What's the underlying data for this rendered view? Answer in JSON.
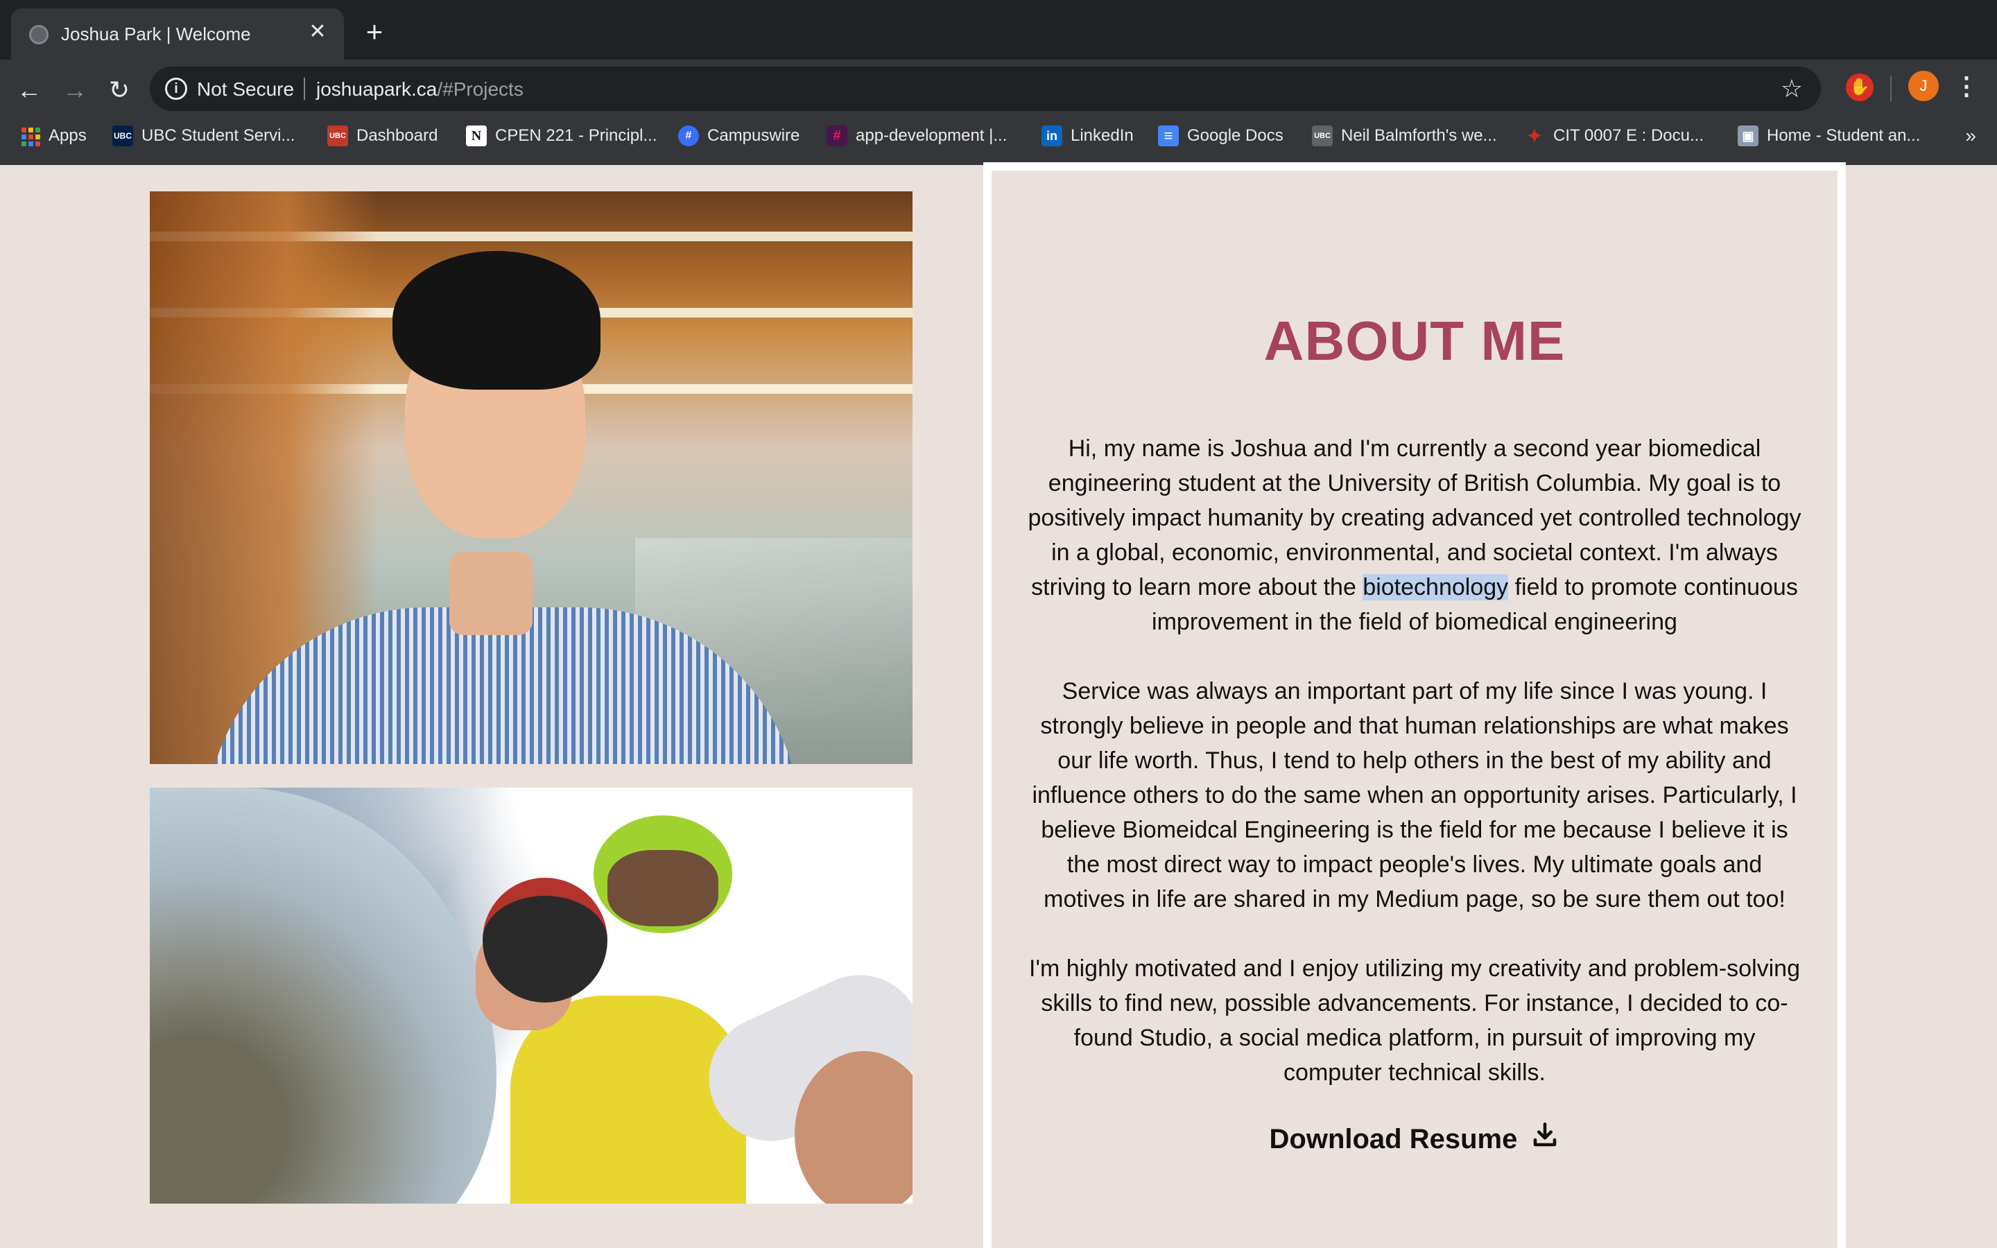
{
  "browser": {
    "tab": {
      "title": "Joshua Park | Welcome",
      "close": "✕",
      "new_tab": "+"
    },
    "nav": {
      "back": "←",
      "forward": "→",
      "reload": "↻"
    },
    "omnibox": {
      "security_label": "Not Secure",
      "url_host": "joshuapark.ca",
      "url_path": "/#Projects"
    },
    "profile_initial": "J",
    "bookmarks": [
      {
        "label": "Apps",
        "icon": "apps-grid-icon"
      },
      {
        "label": "UBC Student Servi...",
        "icon": "ubc-icon",
        "icon_text": "UBC",
        "color": "#002145"
      },
      {
        "label": "Dashboard",
        "icon": "canvas-icon",
        "icon_text": "UBC",
        "color": "#c0392b"
      },
      {
        "label": "CPEN 221 - Principl...",
        "icon": "notion-icon",
        "icon_text": "N",
        "color": "#ffffff"
      },
      {
        "label": "Campuswire",
        "icon": "campuswire-icon",
        "icon_text": "#",
        "color": "#3b6ef5"
      },
      {
        "label": "app-development |...",
        "icon": "slack-icon",
        "icon_text": "#",
        "color": "#4a154b"
      },
      {
        "label": "LinkedIn",
        "icon": "linkedin-icon",
        "icon_text": "in",
        "color": "#0a66c2"
      },
      {
        "label": "Google Docs",
        "icon": "google-docs-icon",
        "icon_text": "≡",
        "color": "#4285f4"
      },
      {
        "label": "Neil Balmforth's we...",
        "icon": "ubc-icon",
        "icon_text": "UBC",
        "color": "#5f6368"
      },
      {
        "label": "CIT 0007 E : Docu...",
        "icon": "maple-leaf-icon",
        "icon_text": "✦",
        "color": "#d52b1e"
      },
      {
        "label": "Home - Student an...",
        "icon": "student-icon",
        "icon_text": "▣",
        "color": "#8d99ae"
      }
    ],
    "bookmarks_more": "»"
  },
  "about": {
    "title": "ABOUT ME",
    "p1_before": "Hi, my name is Joshua and I'm currently a second year biomedical engineering student at the University of British Columbia. My goal is to positively impact humanity by creating advanced yet controlled technology in a global, economic, environmental, and societal context. I'm always striving to learn more about the ",
    "p1_highlight": "biotechnology",
    "p1_after": " field to promote continuous improvement in the field of biomedical engineering",
    "p2": "Service was always an important part of my life since I was young. I strongly believe in people and that human relationships are what makes our life worth. Thus, I tend to help others in the best of my ability and influence others to do the same when an opportunity arises. Particularly, I believe Biomeidcal Engineering is the field for me because I believe it is the most direct way to impact people's lives. My ultimate goals and motives in life are shared in my Medium page, so be sure them out too!",
    "p3": "I'm highly motivated and I enjoy utilizing my creativity and problem-solving skills to find new, possible advancements. For instance, I decided to co-found Studio, a social medica platform, in pursuit of improving my computer technical skills.",
    "download_label": "Download Resume"
  },
  "colors": {
    "page_bg": "#ebe1dc",
    "title_accent": "#a7435d",
    "highlight": "#bcd1ee",
    "chrome_dark": "#202124",
    "chrome_toolbar": "#35363a"
  }
}
